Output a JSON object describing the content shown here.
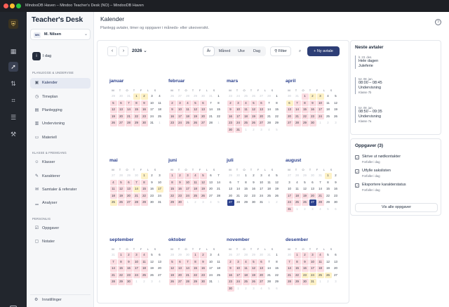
{
  "titlebar": {
    "text": "MindooDB Haven – Mindoo Teacher's Desk (NO) – MindooDB Haven"
  },
  "app": {
    "brand": "Teacher's Desk"
  },
  "user": {
    "initials": "MN",
    "name": "M. Nilsen"
  },
  "sidebar": {
    "today": "I dag",
    "sections": [
      {
        "header": "PLANLEGGE & UNDERVISE",
        "items": [
          "Kalender",
          "Timeplan",
          "Planlegging",
          "Undervisning",
          "Materiell"
        ]
      },
      {
        "header": "KLASSE & FREMGANG",
        "items": [
          "Klasser",
          "Karakterer",
          "Samtaler & referater",
          "Analyser"
        ]
      },
      {
        "header": "PERSONLIG",
        "items": [
          "Oppgaver",
          "Notater"
        ]
      }
    ],
    "active": "Kalender",
    "settings": "Innstillinger"
  },
  "page": {
    "title": "Kalender",
    "subtitle": "Planlegg avtaler, timer og oppgaver i måneds- eller ukeoversikt.",
    "help": "?"
  },
  "toolbar": {
    "prev": "‹",
    "next": "›",
    "year": "2026",
    "views": [
      "År",
      "Måned",
      "Uke",
      "Dag"
    ],
    "active_view": "År",
    "filter": "Filter",
    "new_button": "+ Ny avtale"
  },
  "weekdays": [
    "M",
    "T",
    "O",
    "T",
    "F",
    "L",
    "S"
  ],
  "months": [
    {
      "name": "januar",
      "first": 3,
      "days": 31
    },
    {
      "name": "februar",
      "first": 6,
      "days": 28
    },
    {
      "name": "mars",
      "first": 6,
      "days": 31
    },
    {
      "name": "april",
      "first": 2,
      "days": 30
    },
    {
      "name": "mai",
      "first": 4,
      "days": 31
    },
    {
      "name": "juni",
      "first": 0,
      "days": 30
    },
    {
      "name": "juli",
      "first": 2,
      "days": 31
    },
    {
      "name": "august",
      "first": 5,
      "days": 31
    },
    {
      "name": "september",
      "first": 1,
      "days": 30
    },
    {
      "name": "oktober",
      "first": 3,
      "days": 31
    },
    {
      "name": "november",
      "first": 6,
      "days": 30
    },
    {
      "name": "desember",
      "first": 1,
      "days": 31
    }
  ],
  "highlight_colors": {
    "event": "#fbdde2",
    "holiday": "#fdf1c6",
    "today": "#2a3f8c"
  },
  "upcoming": {
    "title": "Neste avtaler",
    "events": [
      {
        "date": "lr. 23. des.",
        "time": "Hele dagen",
        "title": "Juleferie",
        "sub": ""
      },
      {
        "date": "tor. 08. jan.",
        "time": "08:00 – 08:45",
        "title": "Undervisning",
        "sub": "Klasse 7b"
      },
      {
        "date": "tor. 08. jan.",
        "time": "08:50 – 09:35",
        "title": "Undervisning",
        "sub": "Klasse 7a"
      }
    ]
  },
  "tasks": {
    "title": "Oppgaver (3)",
    "items": [
      {
        "title": "Skrive ut nødkontakter",
        "due": "Forfaller i dag"
      },
      {
        "title": "Utfylle sakslisten",
        "due": "Forfaller i dag"
      },
      {
        "title": "Eksportere karakterstatus",
        "due": "Forfaller i dag"
      }
    ],
    "all_button": "Vis alle oppgaver"
  }
}
